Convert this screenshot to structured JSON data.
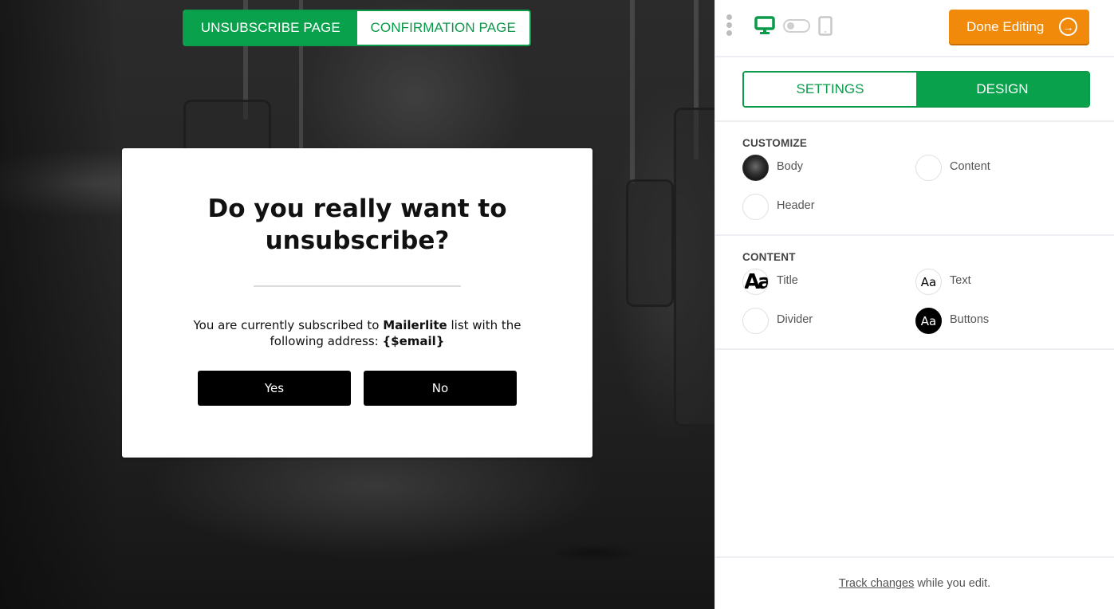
{
  "page_tabs": [
    {
      "label": "UNSUBSCRIBE PAGE",
      "active": true
    },
    {
      "label": "CONFIRMATION PAGE",
      "active": false
    }
  ],
  "modal": {
    "title": "Do you really want to unsubscribe?",
    "text_prefix": "You are currently subscribed to ",
    "list_name": "Mailerlite",
    "text_middle": " list with the following address: ",
    "email_token": "{$email}",
    "buttons": [
      {
        "label": "Yes"
      },
      {
        "label": "No"
      }
    ]
  },
  "topbar": {
    "menu_icon": "kebab-menu-icon",
    "device_desktop_icon": "desktop-icon",
    "device_toggle": "device-toggle",
    "device_tablet_icon": "tablet-icon",
    "done_button_label": "Done Editing",
    "done_button_icon": "arrow-right-circle-icon"
  },
  "mode_tabs": [
    {
      "label": "SETTINGS",
      "active": false
    },
    {
      "label": "DESIGN",
      "active": true
    }
  ],
  "customize": {
    "title": "CUSTOMIZE",
    "items": [
      {
        "label": "Body",
        "swatch": "background-image"
      },
      {
        "label": "Content",
        "swatch": "white"
      },
      {
        "label": "Header",
        "swatch": "white"
      }
    ]
  },
  "content": {
    "title": "CONTENT",
    "items": [
      {
        "label": "Title",
        "swatch_glyph": "Aa"
      },
      {
        "label": "Text",
        "swatch_glyph": "Aa"
      },
      {
        "label": "Divider",
        "swatch_glyph": ""
      },
      {
        "label": "Buttons",
        "swatch_glyph": "Aa"
      }
    ]
  },
  "footer": {
    "link_text": "Track changes",
    "rest_text": "while you edit."
  },
  "colors": {
    "brand_green": "#09a14c",
    "done_orange": "#f18a0a",
    "modal_button": "#000000"
  }
}
